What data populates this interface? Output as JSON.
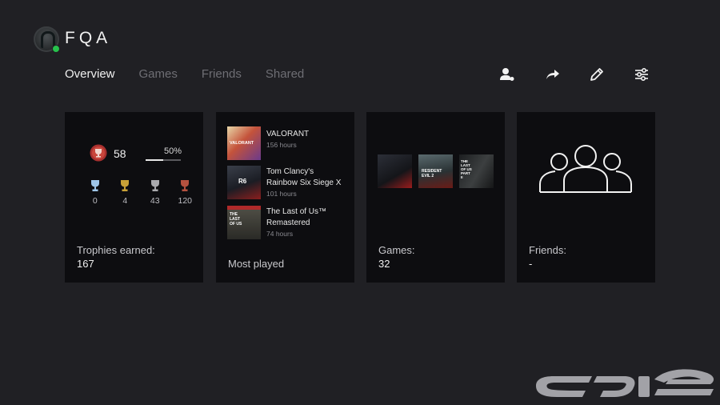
{
  "profile": {
    "username": "FQA",
    "online_color": "#27c24c"
  },
  "tabs": [
    {
      "label": "Overview",
      "active": true
    },
    {
      "label": "Games",
      "active": false
    },
    {
      "label": "Friends",
      "active": false
    },
    {
      "label": "Shared",
      "active": false
    }
  ],
  "toolbar": [
    {
      "icon": "add-friend-icon"
    },
    {
      "icon": "share-icon"
    },
    {
      "icon": "edit-icon"
    },
    {
      "icon": "settings-sliders-icon"
    }
  ],
  "trophies": {
    "level": "58",
    "progress_label": "50%",
    "progress": 0.5,
    "counts": [
      {
        "type": "platinum",
        "count": "0",
        "color": "#9fc6e8"
      },
      {
        "type": "gold",
        "count": "4",
        "color": "#c9a137"
      },
      {
        "type": "silver",
        "count": "43",
        "color": "#a9a9ad"
      },
      {
        "type": "bronze",
        "count": "120",
        "color": "#b4513f"
      }
    ],
    "label": "Trophies earned:",
    "total": "167"
  },
  "most_played": {
    "label": "Most played",
    "games": [
      {
        "title": "VALORANT",
        "hours": "156 hours",
        "thumb_text": "VALORANT"
      },
      {
        "title": "Tom Clancy's Rainbow Six Siege X",
        "hours": "101 hours",
        "thumb_text": "R6"
      },
      {
        "title": "The Last of Us™ Remastered",
        "hours": "74 hours",
        "thumb_text": "THE LAST OF US"
      }
    ]
  },
  "games": {
    "label": "Games:",
    "count": "32",
    "covers": [
      {
        "name": "cover-1",
        "thumb_text": ""
      },
      {
        "name": "cover-2",
        "thumb_text": "RESIDENT EVIL 2"
      },
      {
        "name": "cover-3",
        "thumb_text": "THE LAST OF US PART II"
      }
    ]
  },
  "friends": {
    "label": "Friends:",
    "count": "-"
  }
}
